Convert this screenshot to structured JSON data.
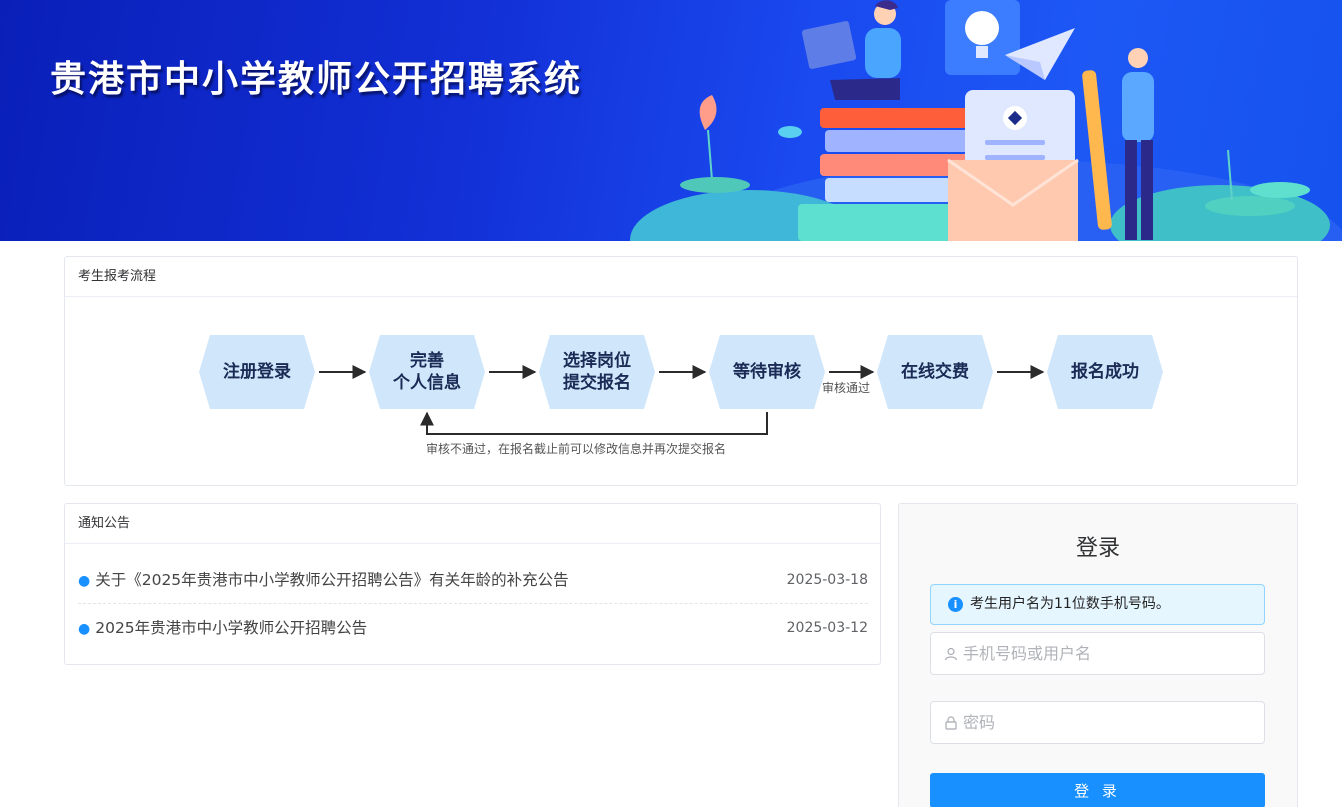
{
  "banner": {
    "title": "贵港市中小学教师公开招聘系统"
  },
  "flow": {
    "header": "考生报考流程",
    "steps": [
      {
        "line1": "注册登录",
        "line2": ""
      },
      {
        "line1": "完善",
        "line2": "个人信息"
      },
      {
        "line1": "选择岗位",
        "line2": "提交报名"
      },
      {
        "line1": "等待审核",
        "line2": ""
      },
      {
        "line1": "在线交费",
        "line2": ""
      },
      {
        "line1": "报名成功",
        "line2": ""
      }
    ],
    "approved_label": "审核通过",
    "rejected_note": "审核不通过，在报名截止前可以修改信息并再次提交报名",
    "step_color": "#cfe6fb",
    "step_text_color": "#1b2b55"
  },
  "notices": {
    "header": "通知公告",
    "items": [
      {
        "title": "关于《2025年贵港市中小学教师公开招聘公告》有关年龄的补充公告",
        "date": "2025-03-18"
      },
      {
        "title": "2025年贵港市中小学教师公开招聘公告",
        "date": "2025-03-12"
      }
    ]
  },
  "login": {
    "title": "登录",
    "alert": "考生用户名为11位数手机号码。",
    "username_placeholder": "手机号码或用户名",
    "username_value": "",
    "password_placeholder": "密码",
    "password_value": "",
    "button_label": "登 录",
    "accent_color": "#1890ff"
  }
}
